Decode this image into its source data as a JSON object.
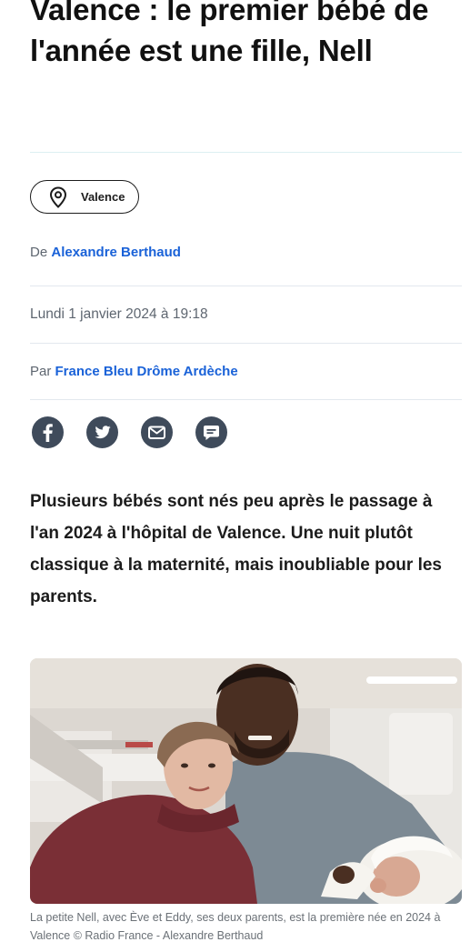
{
  "article": {
    "headline": "Valence : le premier bébé de l'année est une fille, Nell",
    "location_tag": "Valence",
    "author_prefix": "De",
    "author_name": "Alexandre Berthaud",
    "date": "Lundi 1 janvier 2024 à 19:18",
    "source_prefix": "Par",
    "source_name": "France Bleu Drôme Ardèche",
    "lede": "Plusieurs bébés sont nés peu après le passage à l'an 2024 à l'hôpital de Valence. Une nuit plutôt classique à la maternité, mais inoubliable pour les parents.",
    "photo_caption": "La petite Nell, avec Ève et Eddy, ses deux parents, est la première née en 2024 à Valence © Radio France - Alexandre Berthaud"
  },
  "share": {
    "icons": [
      "facebook-icon",
      "twitter-icon",
      "email-icon",
      "comment-icon"
    ]
  },
  "colors": {
    "link": "#1a62d8",
    "share_button": "#3f4b5b",
    "meta_text": "#5e6670",
    "divider": "#e3e8ee"
  }
}
